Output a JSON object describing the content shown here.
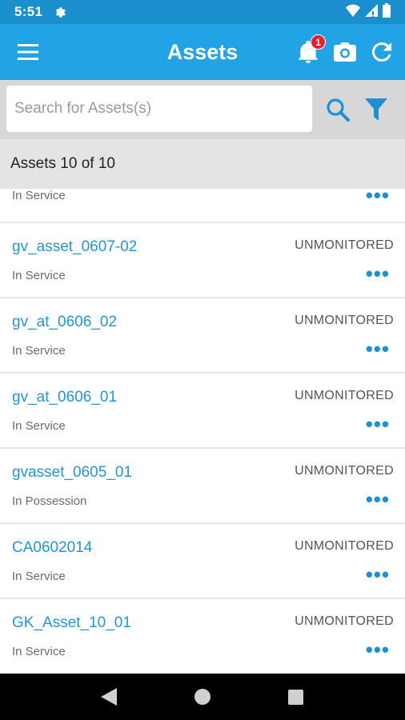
{
  "status_bar": {
    "time": "5:51"
  },
  "app_bar": {
    "title": "Assets",
    "notification_count": "1"
  },
  "search": {
    "placeholder": "Search for Assets(s)"
  },
  "list_header": {
    "count_text": "Assets 10 of 10"
  },
  "partial_row": {
    "status": "In Service",
    "more": "•••"
  },
  "assets": [
    {
      "name": "gv_asset_0607-02",
      "status": "In Service",
      "monitoring": "UNMONITORED",
      "more": "•••"
    },
    {
      "name": "gv_at_0606_02",
      "status": "In Service",
      "monitoring": "UNMONITORED",
      "more": "•••"
    },
    {
      "name": "gv_at_0606_01",
      "status": "In Service",
      "monitoring": "UNMONITORED",
      "more": "•••"
    },
    {
      "name": "gvasset_0605_01",
      "status": "In Possession",
      "monitoring": "UNMONITORED",
      "more": "•••"
    },
    {
      "name": "CA0602014",
      "status": "In Service",
      "monitoring": "UNMONITORED",
      "more": "•••"
    },
    {
      "name": "GK_Asset_10_01",
      "status": "In Service",
      "monitoring": "UNMONITORED",
      "more": "•••"
    }
  ],
  "colors": {
    "status_bar": "#1b8fce",
    "app_bar": "#21a3e6",
    "link": "#2396d6",
    "badge": "#e8202c"
  },
  "icons": [
    "gear-icon",
    "wifi-icon",
    "signal-icon",
    "battery-icon",
    "menu-icon",
    "bell-icon",
    "camera-icon",
    "refresh-icon",
    "search-icon",
    "filter-icon",
    "back-icon",
    "home-icon",
    "recents-icon"
  ]
}
